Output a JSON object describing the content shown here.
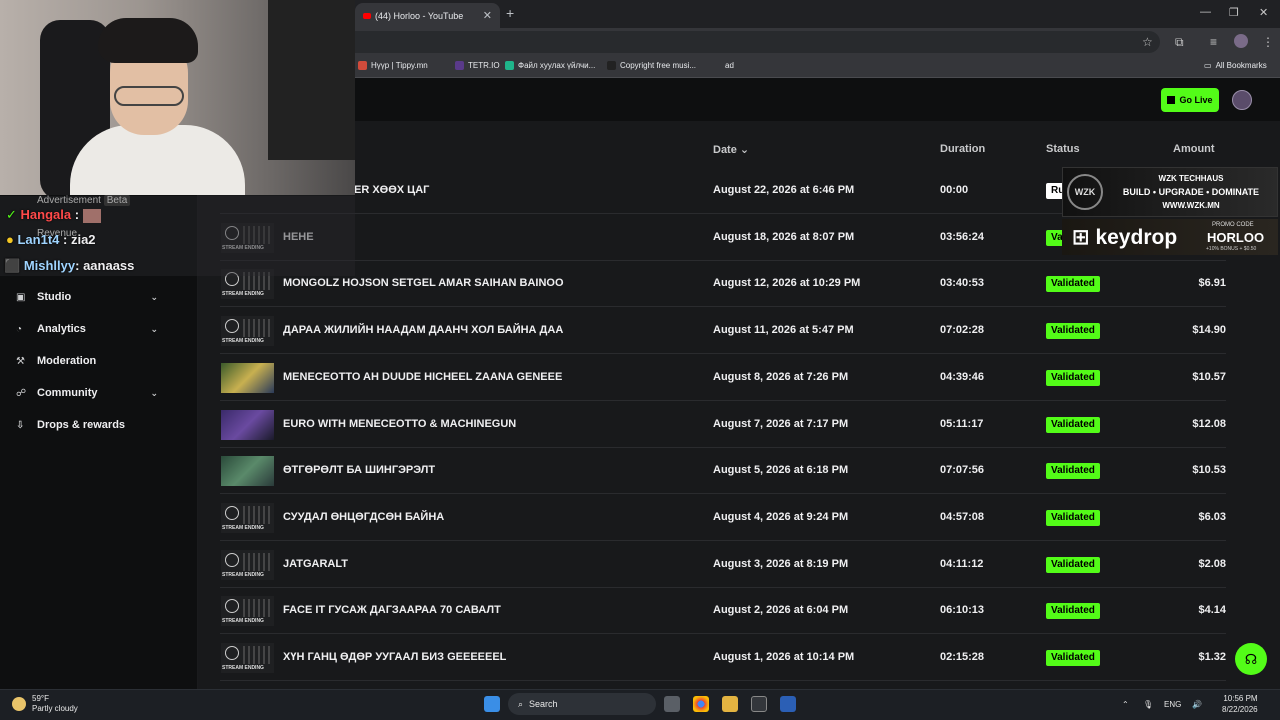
{
  "browser": {
    "tab_title": "(44) Horloo - YouTube",
    "bookmarks": [
      {
        "label": "Нүүр | Tippy.mn",
        "color": "#d14b3b"
      },
      {
        "label": "TETR.IO",
        "color": "#5a3a8a"
      },
      {
        "label": "Файл хуулах үйлчи...",
        "color": "#1fb58a"
      },
      {
        "label": "Copyright free musi...",
        "color": "#222222"
      },
      {
        "label": "ad",
        "color": "#35363a"
      }
    ],
    "all_bookmarks": "All Bookmarks"
  },
  "header": {
    "go_live": "Go Live"
  },
  "sidebar": {
    "items": [
      {
        "label": "Studio",
        "icon": "studio-icon",
        "expandable": true
      },
      {
        "label": "Analytics",
        "icon": "analytics-icon",
        "expandable": true
      },
      {
        "label": "Moderation",
        "icon": "moderation-icon",
        "expandable": false
      },
      {
        "label": "Community",
        "icon": "community-icon",
        "expandable": true
      },
      {
        "label": "Drops & rewards",
        "icon": "drops-icon",
        "expandable": false
      }
    ],
    "partial_items": [
      "Advertisement",
      "Beta",
      "Revenue"
    ]
  },
  "table": {
    "columns": {
      "date": "Date",
      "duration": "Duration",
      "status": "Status",
      "amount": "Amount"
    },
    "rows": [
      {
        "title": "ER ХӨӨХ ЦАГ",
        "date": "August 22, 2026 at 6:46 PM",
        "duration": "00:00",
        "status": "Ru",
        "amount": "",
        "thumb": "none"
      },
      {
        "title": "НЕНЕ",
        "date": "August 18, 2026 at 8:07 PM",
        "duration": "03:56:24",
        "status": "Va",
        "amount": "",
        "thumb": "stream"
      },
      {
        "title": "MONGOLZ HOJSON SETGEL AMAR SAIHAN BAINOO",
        "date": "August 12, 2026 at 10:29 PM",
        "duration": "03:40:53",
        "status": "Validated",
        "amount": "$6.91",
        "thumb": "stream"
      },
      {
        "title": "ДАРАА ЖИЛИЙН НААДАМ ДААНЧ ХОЛ БАЙНА ДАА",
        "date": "August 11, 2026 at 5:47 PM",
        "duration": "07:02:28",
        "status": "Validated",
        "amount": "$14.90",
        "thumb": "stream"
      },
      {
        "title": "MENECEOTTO AH DUUDE HICHEEL ZAANA GENEEE",
        "date": "August 8, 2026 at 7:26 PM",
        "duration": "04:39:46",
        "status": "Validated",
        "amount": "$10.57",
        "thumb": "game1"
      },
      {
        "title": "EURO WITH MENECEOTTO & MACHINEGUN",
        "date": "August 7, 2026 at 7:17 PM",
        "duration": "05:11:17",
        "status": "Validated",
        "amount": "$12.08",
        "thumb": "game2"
      },
      {
        "title": "ӨТГӨРӨЛТ БА ШИНГЭРЭЛТ",
        "date": "August 5, 2026 at 6:18 PM",
        "duration": "07:07:56",
        "status": "Validated",
        "amount": "$10.53",
        "thumb": "game3"
      },
      {
        "title": "СУУДАЛ ӨНЦӨГДСӨН БАЙНА",
        "date": "August 4, 2026 at 9:24 PM",
        "duration": "04:57:08",
        "status": "Validated",
        "amount": "$6.03",
        "thumb": "stream"
      },
      {
        "title": "JATGARALT",
        "date": "August 3, 2026 at 8:19 PM",
        "duration": "04:11:12",
        "status": "Validated",
        "amount": "$2.08",
        "thumb": "stream"
      },
      {
        "title": "FACE IT ГУСАЖ ДАГЗААРАА 70 САВАЛТ",
        "date": "August 2, 2026 at 6:04 PM",
        "duration": "06:10:13",
        "status": "Validated",
        "amount": "$4.14",
        "thumb": "stream"
      },
      {
        "title": "ХҮН ГАНЦ ӨДӨР УУГААЛ БИЗ GEEEEEEL",
        "date": "August 1, 2026 at 10:14 PM",
        "duration": "02:15:28",
        "status": "Validated",
        "amount": "$1.32",
        "thumb": "stream"
      }
    ],
    "thumb_label": "STREAM ENDING"
  },
  "chat": [
    {
      "user": "Hangala",
      "sep": " :",
      "msg": "",
      "color": "#ff4a4a"
    },
    {
      "user": "Lan1t4",
      "sep": " :",
      "msg": " zia2",
      "color": "#9fd4ff"
    },
    {
      "user": "Mishllyy",
      "sep": ":",
      "msg": " aanaass",
      "color": "#9fd4ff"
    }
  ],
  "promo": {
    "wzk_logo": "WZK",
    "wzk_title": "WZK TECHHAUS",
    "wzk_tagline": "BUILD • UPGRADE • DOMINATE",
    "wzk_url": "WWW.WZK.MN",
    "keydrop": "keydrop",
    "promo_code_label": "PROMO CODE",
    "promo_code": "HORLOO",
    "promo_bonus": "+10% BONUS + $0.50"
  },
  "taskbar": {
    "temp": "59°F",
    "weather": "Partly cloudy",
    "search": "Search",
    "lang": "ENG",
    "time": "10:56 PM",
    "date": "8/22/2026"
  }
}
